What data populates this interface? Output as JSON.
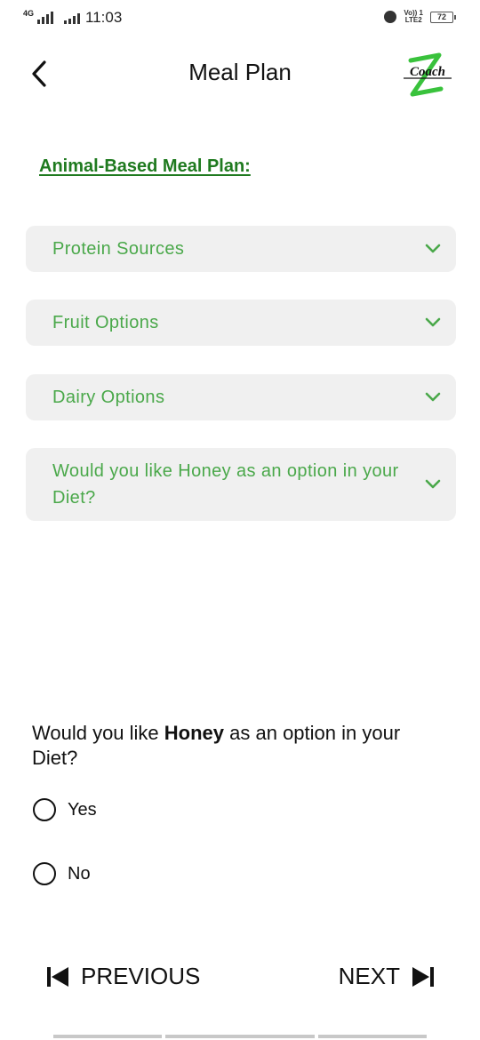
{
  "status_bar": {
    "network": "4G",
    "time": "11:03",
    "volte_line1": "Vo)) 1",
    "volte_line2": "LTE2",
    "battery": "72"
  },
  "header": {
    "title": "Meal Plan",
    "logo_text": "Coach"
  },
  "section_title": "Animal-Based Meal Plan:",
  "accordion": [
    {
      "label": "Protein Sources"
    },
    {
      "label": "Fruit Options"
    },
    {
      "label": "Dairy Options"
    },
    {
      "label": "Would you like Honey as an option in your Diet?"
    }
  ],
  "question": {
    "prefix": "Would you like ",
    "bold": "Honey",
    "suffix": " as an option in your Diet?"
  },
  "options": [
    {
      "label": "Yes"
    },
    {
      "label": "No"
    }
  ],
  "nav": {
    "previous": "PREVIOUS",
    "next": "NEXT"
  },
  "colors": {
    "accent_green": "#4aa84a",
    "title_green": "#1f7a1f",
    "logo_green": "#39c23c",
    "card_bg": "#f0f0f0"
  }
}
